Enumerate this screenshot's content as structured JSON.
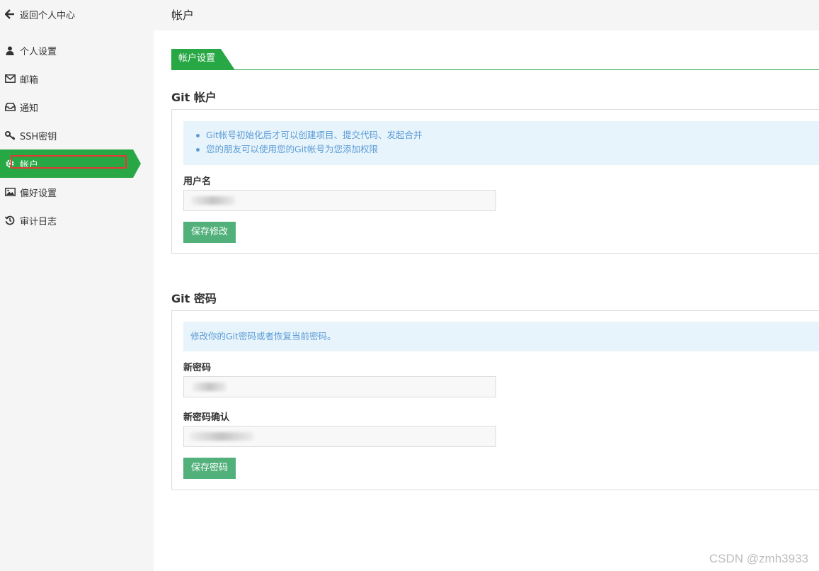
{
  "sidebar": {
    "back_label": "返回个人中心",
    "items": [
      {
        "label": "个人设置",
        "icon": "user-icon"
      },
      {
        "label": "邮箱",
        "icon": "envelope-icon"
      },
      {
        "label": "通知",
        "icon": "inbox-icon"
      },
      {
        "label": "SSH密钥",
        "icon": "key-icon"
      },
      {
        "label": "帐户",
        "icon": "gear-icon",
        "active": true
      },
      {
        "label": "偏好设置",
        "icon": "image-icon"
      },
      {
        "label": "审计日志",
        "icon": "history-icon"
      }
    ]
  },
  "header": {
    "title": "帐户"
  },
  "tab": {
    "label": "帐户设置"
  },
  "git_account": {
    "title": "Git 帐户",
    "info": [
      "Git帐号初始化后才可以创建项目、提交代码、发起合并",
      "您的朋友可以使用您的Git帐号为您添加权限"
    ],
    "username_label": "用户名",
    "save_label": "保存修改"
  },
  "git_password": {
    "title": "Git 密码",
    "info": "修改你的Git密码或者恢复当前密码。",
    "new_password_label": "新密码",
    "confirm_label": "新密码确认",
    "save_label": "保存密码"
  },
  "watermark": "CSDN @zmh3933",
  "colors": {
    "accent": "#28a745",
    "button": "#52b07a",
    "info_bg": "#e8f4fc",
    "info_text": "#5b9bd5",
    "highlight": "#e53935"
  }
}
